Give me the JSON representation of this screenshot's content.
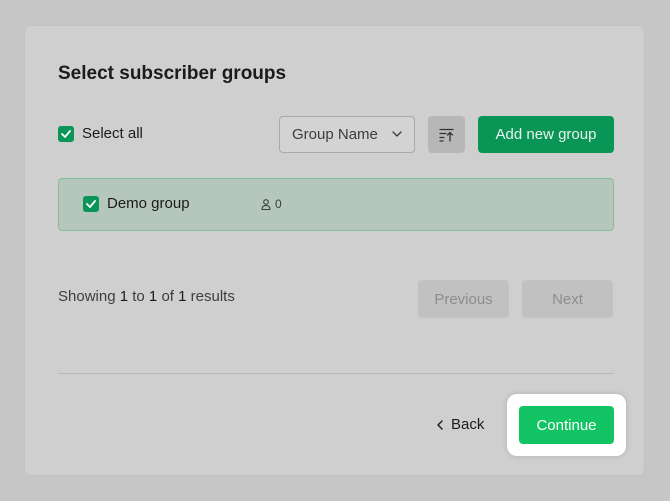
{
  "page": {
    "title": "Select subscriber groups"
  },
  "toolbar": {
    "select_all_label": "Select all",
    "select_all_checked": true,
    "sort_field": "Group Name",
    "sort_icon": "sort-ascending-icon",
    "add_group_label": "Add new group"
  },
  "groups": [
    {
      "name": "Demo group",
      "checked": true,
      "member_icon": "user-icon",
      "member_count": "0"
    }
  ],
  "pagination": {
    "prefix": "Showing",
    "from": "1",
    "to_word": "to",
    "to": "1",
    "of_word": "of",
    "total": "1",
    "suffix": "results",
    "previous_label": "Previous",
    "next_label": "Next"
  },
  "footer": {
    "back_label": "Back",
    "continue_label": "Continue"
  },
  "colors": {
    "primary_green": "#099556",
    "continue_green": "#12c464",
    "selected_row_bg": "#b5c7bd"
  }
}
